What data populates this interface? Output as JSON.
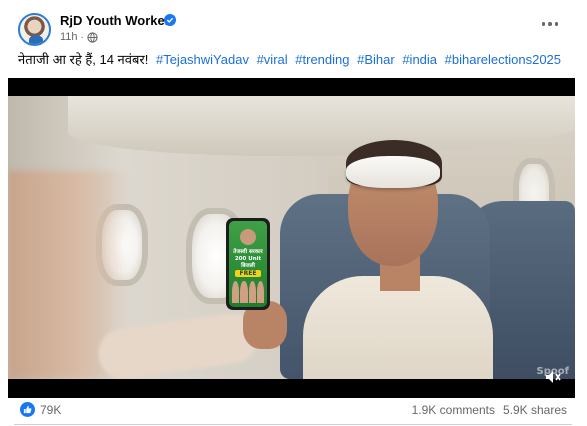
{
  "post": {
    "author": "RjD Youth Worker",
    "time": "11h",
    "separator": "·",
    "caption_text": "नेताजी आ रहे हैं, 14 नवंबर!",
    "hashtags": [
      "#TejashwiYadav",
      "#viral",
      "#trending",
      "#Bihar",
      "#india",
      "#biharelections2025"
    ]
  },
  "video": {
    "phone_text": "तेजस्वी सरकार 200 Unit बिजली",
    "phone_badge": "FREE",
    "watermark": "Spoof"
  },
  "footer": {
    "reactions_count": "79K",
    "comments": "1.9K comments",
    "shares": "5.9K shares"
  },
  "colors": {
    "accent": "#1877f2",
    "hashtag": "#1b6fd8",
    "muted_text": "#65676b"
  },
  "icons": {
    "verified": "verified-badge-icon",
    "audience": "globe-icon",
    "options": "more-options-icon",
    "sound": "volume-icon",
    "reaction": "like-icon"
  }
}
